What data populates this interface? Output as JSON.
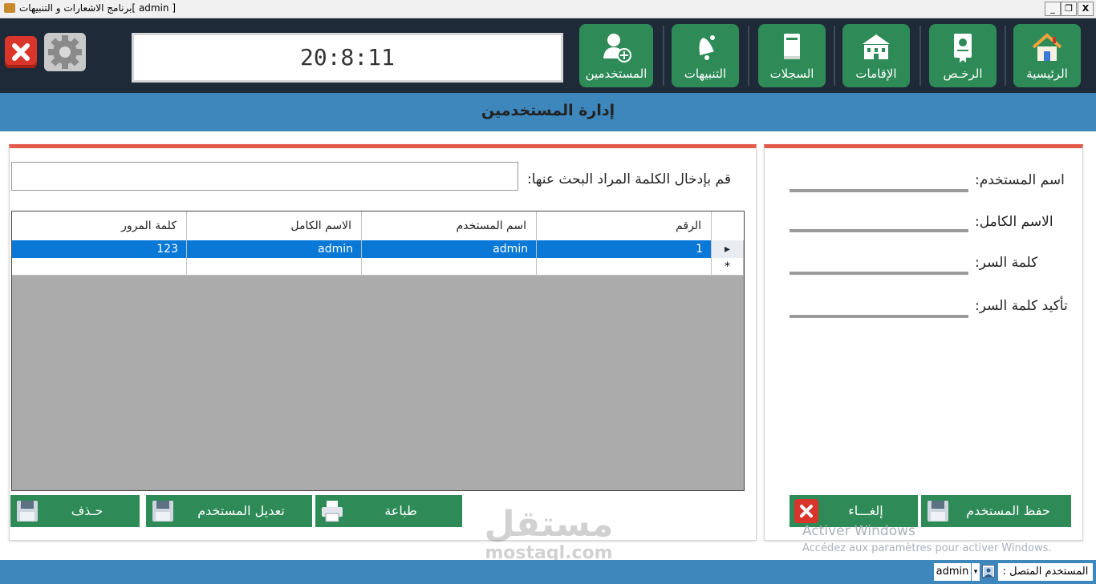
{
  "window": {
    "title": "[ admin ]برنامج الاشعارات و التنبيهات",
    "controls": {
      "minimize": "_",
      "restore": "❐",
      "close": "X"
    }
  },
  "topbar": {
    "clock": "20:8:11",
    "tiles": [
      {
        "id": "home",
        "label": "الرئيسية",
        "icon": "house-icon"
      },
      {
        "id": "licenses",
        "label": "الرخـص",
        "icon": "certificate-icon"
      },
      {
        "id": "residencies",
        "label": "الإقامات",
        "icon": "building-icon"
      },
      {
        "id": "records",
        "label": "السجلات",
        "icon": "book-icon"
      },
      {
        "id": "alerts",
        "label": "التنبيهات",
        "icon": "bell-icon"
      },
      {
        "id": "users",
        "label": "المستخدمين",
        "icon": "add-user-icon"
      }
    ]
  },
  "page": {
    "title": "إدارة المستخدمين"
  },
  "form": {
    "username_label": "اسم المستخدم:",
    "fullname_label": "الاسم الكامل:",
    "password_label": "كلمة السر:",
    "confirm_label": "تأكيد كلمة السر:",
    "username_value": "",
    "fullname_value": "",
    "password_value": "",
    "confirm_value": "",
    "save_label": "حفظ المستخدم",
    "cancel_label": "إلغـــاء"
  },
  "search": {
    "label": "قم بإدخال الكلمة المراد البحث عنها:",
    "value": ""
  },
  "table": {
    "columns": [
      "الرقم",
      "اسم المستخدم",
      "الاسم الكامل",
      "كلمة المرور"
    ],
    "rows": [
      {
        "number": "1",
        "username": "admin",
        "fullname": "admin",
        "password": "123"
      }
    ],
    "new_row_marker": "*",
    "current_row_marker": "▸"
  },
  "actions": {
    "print_label": "طباعة",
    "edit_label": "تعديل المستخدم",
    "delete_label": "حـذف"
  },
  "status": {
    "label": "المستخدم المتصل :",
    "user": "admin"
  },
  "overlay": {
    "activate_title": "Activer Windows",
    "activate_sub": "Accédez aux paramètres pour activer Windows.",
    "logo_text": "مستقل",
    "logo_sub": "mostaql.com"
  },
  "colors": {
    "accent_green": "#2e8b57",
    "accent_blue": "#3d87bd",
    "panel_red": "#e35b4b",
    "dark_bar": "#1f2a38",
    "row_select": "#0a78d7"
  }
}
